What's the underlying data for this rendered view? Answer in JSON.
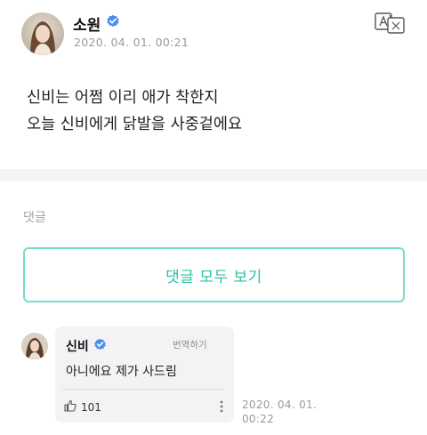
{
  "post": {
    "author": "소원",
    "timestamp": "2020. 04. 01. 00:21",
    "body_lines": [
      "신비는 어쩜 이리 애가 착한지",
      "오늘 신비에게 닭발을 사중겉에요"
    ]
  },
  "comments": {
    "label": "댓글",
    "view_all_label": "댓글 모두 보기",
    "items": [
      {
        "author": "신비",
        "translate_label": "번역하기",
        "text": "아니에요 제가 사드림",
        "likes": "101",
        "timestamp_line1": "2020. 04. 01.",
        "timestamp_line2": "00:22"
      }
    ]
  },
  "colors": {
    "accent": "#2bc1a4",
    "accent_border": "#79dbcb",
    "verified": "#4a8df0"
  }
}
